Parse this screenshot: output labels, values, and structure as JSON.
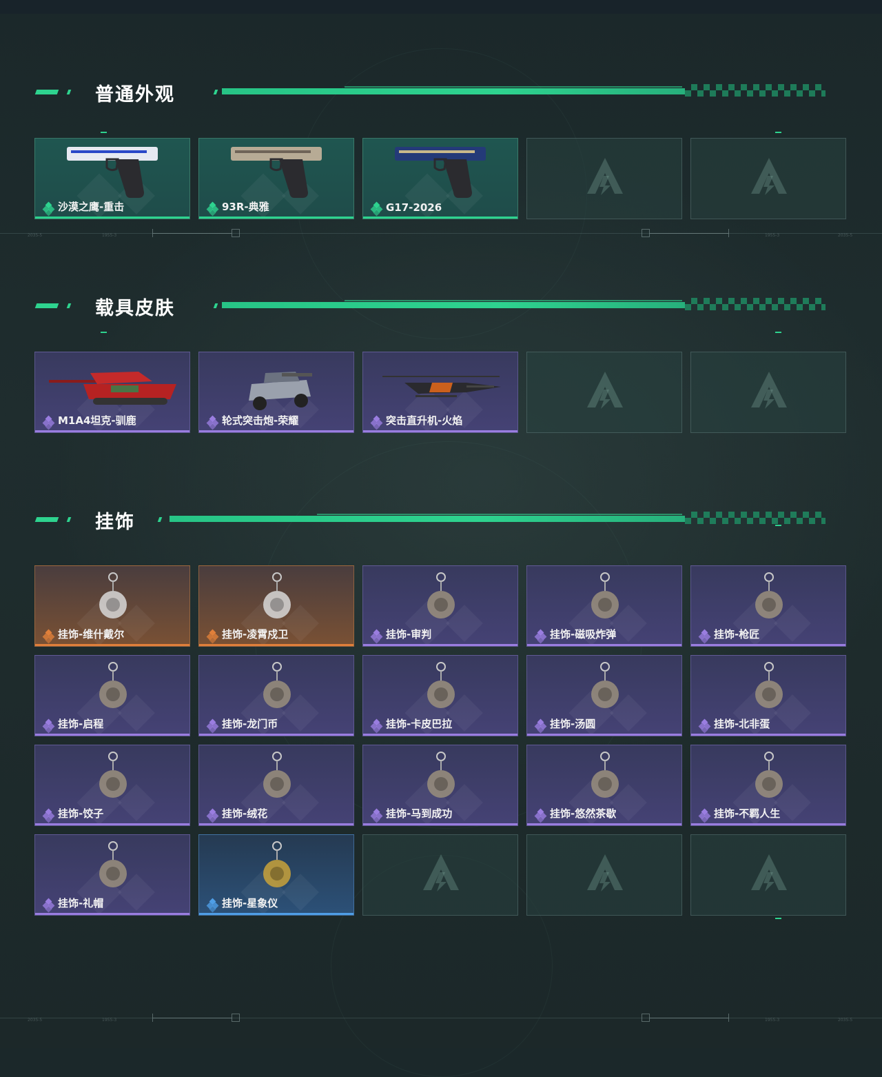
{
  "sections": [
    {
      "title": "普通外观",
      "items": [
        {
          "label": "沙漠之鹰-重击",
          "rarity": "green",
          "icon": "desert-eagle-pistol-icon"
        },
        {
          "label": "93R-典雅",
          "rarity": "green",
          "icon": "93r-pistol-icon"
        },
        {
          "label": "G17-2026",
          "rarity": "green",
          "icon": "g17-pistol-icon"
        },
        {
          "label": "",
          "rarity": "empty",
          "icon": "placeholder-logo-icon"
        },
        {
          "label": "",
          "rarity": "empty",
          "icon": "placeholder-logo-icon"
        }
      ]
    },
    {
      "title": "载具皮肤",
      "items": [
        {
          "label": "M1A4坦克-驯鹿",
          "rarity": "purple",
          "icon": "tank-icon"
        },
        {
          "label": "轮式突击炮-荣耀",
          "rarity": "purple",
          "icon": "wheeled-assault-gun-icon"
        },
        {
          "label": "突击直升机-火焰",
          "rarity": "purple",
          "icon": "helicopter-icon"
        },
        {
          "label": "",
          "rarity": "empty",
          "icon": "placeholder-logo-icon"
        },
        {
          "label": "",
          "rarity": "empty",
          "icon": "placeholder-logo-icon"
        }
      ]
    },
    {
      "title": "挂饰",
      "items": [
        {
          "label": "挂饰-维什戴尔",
          "rarity": "orange",
          "icon": "charm-icon"
        },
        {
          "label": "挂饰-凌霄戍卫",
          "rarity": "orange",
          "icon": "charm-icon"
        },
        {
          "label": "挂饰-审判",
          "rarity": "purple",
          "icon": "charm-icon"
        },
        {
          "label": "挂饰-磁吸炸弹",
          "rarity": "purple",
          "icon": "charm-icon"
        },
        {
          "label": "挂饰-枪匠",
          "rarity": "purple",
          "icon": "charm-icon"
        },
        {
          "label": "挂饰-启程",
          "rarity": "purple",
          "icon": "charm-icon"
        },
        {
          "label": "挂饰-龙门币",
          "rarity": "purple",
          "icon": "charm-icon"
        },
        {
          "label": "挂饰-卡皮巴拉",
          "rarity": "purple",
          "icon": "charm-icon"
        },
        {
          "label": "挂饰-汤圆",
          "rarity": "purple",
          "icon": "charm-icon"
        },
        {
          "label": "挂饰-北非蛋",
          "rarity": "purple",
          "icon": "charm-icon"
        },
        {
          "label": "挂饰-饺子",
          "rarity": "purple",
          "icon": "charm-icon"
        },
        {
          "label": "挂饰-绒花",
          "rarity": "purple",
          "icon": "charm-icon"
        },
        {
          "label": "挂饰-马到成功",
          "rarity": "purple",
          "icon": "charm-icon"
        },
        {
          "label": "挂饰-悠然茶歇",
          "rarity": "purple",
          "icon": "charm-icon"
        },
        {
          "label": "挂饰-不羁人生",
          "rarity": "purple",
          "icon": "charm-icon"
        },
        {
          "label": "挂饰-礼帽",
          "rarity": "purple",
          "icon": "charm-icon"
        },
        {
          "label": "挂饰-星象仪",
          "rarity": "blue",
          "icon": "charm-icon"
        },
        {
          "label": "",
          "rarity": "empty",
          "icon": "placeholder-logo-icon"
        },
        {
          "label": "",
          "rarity": "empty",
          "icon": "placeholder-logo-icon"
        },
        {
          "label": "",
          "rarity": "empty",
          "icon": "placeholder-logo-icon"
        }
      ]
    }
  ],
  "hud": {
    "tag_left": "2035-5",
    "tag_mid_left": "1955-3",
    "tag_mid_right": "1955-3",
    "tag_right": "2035-5"
  },
  "colors": {
    "accent": "#2ed38f",
    "purple_rarity": "#9a7de0",
    "orange_rarity": "#e07f3a",
    "blue_rarity": "#4f9ee6",
    "green_rarity": "#2ed38f"
  }
}
